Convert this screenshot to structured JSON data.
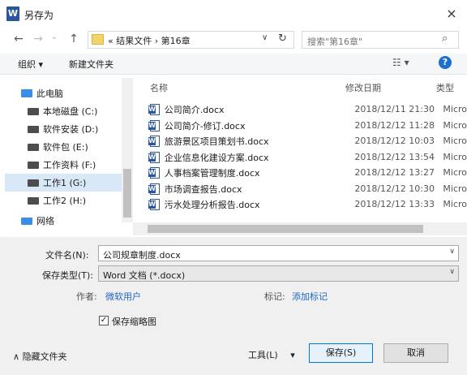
{
  "window": {
    "title": "另存为",
    "close": "×"
  },
  "nav": {
    "back": "←",
    "forward": "→",
    "history": "⌄",
    "up": "↑"
  },
  "address": {
    "prefix": "«",
    "path1": "结果文件",
    "sep": "›",
    "path2": "第16章",
    "dropdown": "∨",
    "refresh": "↻"
  },
  "search": {
    "placeholder": "搜索\"第16章\"",
    "icon": "⌕"
  },
  "toolbar": {
    "organize": "组织 ▾",
    "new_folder": "新建文件夹",
    "view": "☷ ▾",
    "help": "?"
  },
  "sidebar": {
    "items": [
      {
        "label": "此电脑"
      },
      {
        "label": "本地磁盘 (C:)"
      },
      {
        "label": "软件安装 (D:)"
      },
      {
        "label": "软件包 (E:)"
      },
      {
        "label": "工作资料 (F:)"
      },
      {
        "label": "工作1 (G:)"
      },
      {
        "label": "工作2 (H:)"
      },
      {
        "label": "网络"
      }
    ]
  },
  "columns": {
    "name": "名称",
    "date": "修改日期",
    "type": "类型"
  },
  "files": [
    {
      "name": "公司简介.docx",
      "date": "2018/12/11 21:30",
      "type": "Micro"
    },
    {
      "name": "公司简介-修订.docx",
      "date": "2018/12/12 11:28",
      "type": "Micro"
    },
    {
      "name": "旅游景区项目策划书.docx",
      "date": "2018/12/12 10:03",
      "type": "Micro"
    },
    {
      "name": "企业信息化建设方案.docx",
      "date": "2018/12/12 13:54",
      "type": "Micro"
    },
    {
      "name": "人事档案管理制度.docx",
      "date": "2018/12/12 13:27",
      "type": "Micro"
    },
    {
      "name": "市场调查报告.docx",
      "date": "2018/12/12 10:30",
      "type": "Micro"
    },
    {
      "name": "污水处理分析报告.docx",
      "date": "2018/12/12 13:33",
      "type": "Micro"
    }
  ],
  "form": {
    "filename_label": "文件名(N):",
    "filename_value": "公司规章制度.docx",
    "filetype_label": "保存类型(T):",
    "filetype_value": "Word 文档 (*.docx)",
    "author_label": "作者:",
    "author_value": "微软用户",
    "tags_label": "标记:",
    "tags_value": "添加标记",
    "thumbnail_label": "保存缩略图",
    "thumbnail_checked": "✓"
  },
  "footer": {
    "hide_folders": "隐藏文件夹",
    "tools": "工具(L)",
    "tools_arrow": "▾",
    "save": "保存(S)",
    "cancel": "取消"
  }
}
